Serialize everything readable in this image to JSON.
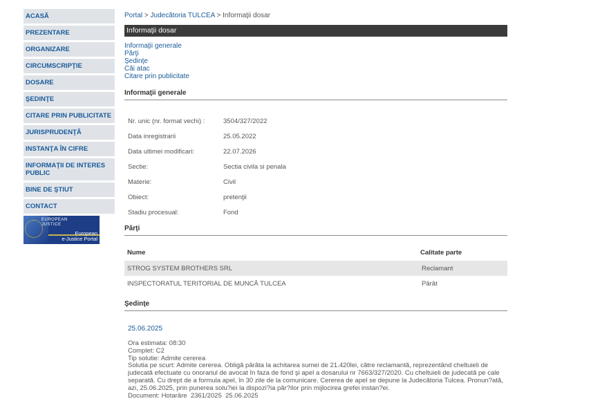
{
  "sidebar": {
    "items": [
      {
        "label": "ACASĂ"
      },
      {
        "label": "PREZENTARE"
      },
      {
        "label": "ORGANIZARE"
      },
      {
        "label": "CIRCUMSCRIPŢIE"
      },
      {
        "label": "DOSARE"
      },
      {
        "label": "ŞEDINŢE"
      },
      {
        "label": "CITARE PRIN PUBLICITATE"
      },
      {
        "label": "JURISPRUDENŢĂ"
      },
      {
        "label": "INSTANŢA ÎN CIFRE"
      },
      {
        "label": "INFORMAŢII DE INTERES PUBLIC"
      },
      {
        "label": "BINE DE ŞTIUT"
      },
      {
        "label": "CONTACT"
      }
    ],
    "logo": {
      "line1": "EUROPEAN",
      "line2": "JUSTICE",
      "portal1": "European",
      "portal2": "e-Justice Portal"
    }
  },
  "breadcrumb": {
    "portal": "Portal",
    "sep1": " > ",
    "court": "Judecătoria TULCEA",
    "sep2": " > ",
    "current": "Informaţii dosar"
  },
  "title": "Informaţii dosar",
  "quicklinks": [
    "Informaţii generale",
    "Părţi",
    "Şedinţe",
    "Căi atac",
    "Citare prin publicitate"
  ],
  "general": {
    "heading": "Informaţii generale",
    "rows": [
      {
        "label": "Nr. unic (nr. format vechi) :",
        "value": "3504/327/2022"
      },
      {
        "label": "Data inregistrarii",
        "value": "25.05.2022"
      },
      {
        "label": "Data ultimei modificari:",
        "value": "22.07.2026"
      },
      {
        "label": "Sectie:",
        "value": "Sectia civila si penala"
      },
      {
        "label": "Materie:",
        "value": "Civil"
      },
      {
        "label": "Obiect:",
        "value": "pretenţii"
      },
      {
        "label": "Stadiu procesual:",
        "value": "Fond"
      }
    ]
  },
  "parti": {
    "heading": "Părţi",
    "columns": {
      "name": "Nume",
      "role": "Calitate parte"
    },
    "rows": [
      {
        "name": "STROG SYSTEM BROTHERS SRL",
        "role": "Reclamant"
      },
      {
        "name": "INSPECTORATUL TERITORIAL DE MUNCĂ TULCEA",
        "role": "Pârât"
      }
    ]
  },
  "sedinte": {
    "heading": "Şedinţe",
    "date": "25.06.2025",
    "lines": [
      "Ora estimata: 08:30",
      "Complet: C2",
      "Tip solutie: Admite cererea",
      "Solutia pe scurt: Admite cererea. Obligă pârâta la achitarea sumei de 21.420lei, către reclamantă, reprezentând cheltuieli de judecată efectuate cu onorariul de avocat în faza de fond şi apel a dosarului nr 7663/327/2020. Cu cheltuieli de judecată pe cale separată. Cu drept de a formula apel, în 30 zile de la comunicare. Cererea de apel se depune la Judecătoria Tulcea. Pronun?ată, azi, 25.06.2025, prin punerea solu?iei la dispozi?ia păr?ilor prin mijlocirea grefei instan?ei.",
      "Document: Hotarâre  2361/2025  25.06.2025"
    ]
  }
}
